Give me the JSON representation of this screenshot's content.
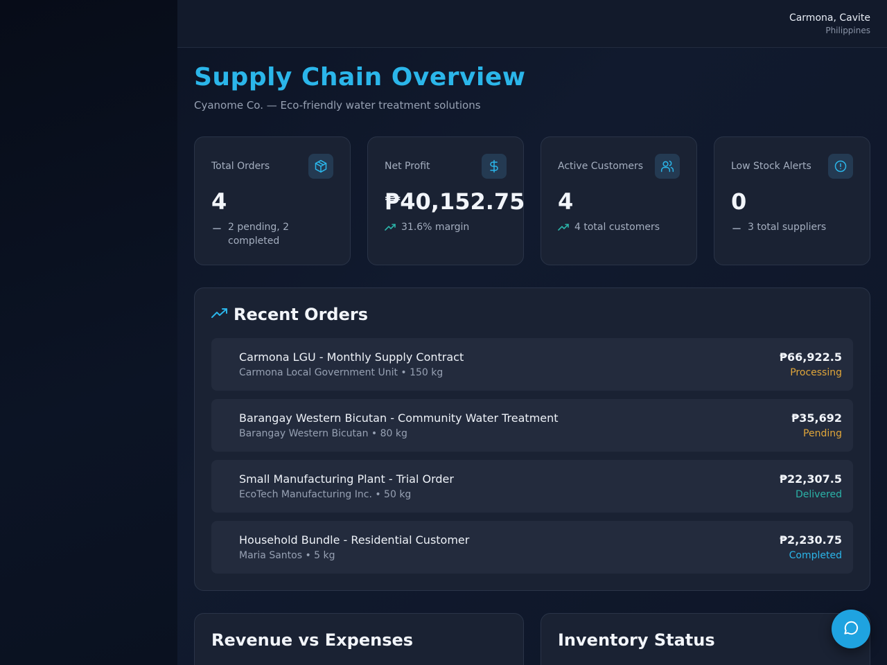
{
  "header": {
    "city": "Carmona, Cavite",
    "country": "Philippines"
  },
  "page": {
    "title": "Supply Chain Overview",
    "subtitle": "Cyanome Co. — Eco-friendly water treatment solutions"
  },
  "stats": [
    {
      "label": "Total Orders",
      "value": "4",
      "footnote": "2 pending, 2 completed",
      "icon": "package-icon",
      "trend": "neutral"
    },
    {
      "label": "Net Profit",
      "value": "₱40,152.75",
      "footnote": "31.6% margin",
      "icon": "dollar-icon",
      "trend": "up"
    },
    {
      "label": "Active Customers",
      "value": "4",
      "footnote": "4 total customers",
      "icon": "users-icon",
      "trend": "up"
    },
    {
      "label": "Low Stock Alerts",
      "value": "0",
      "footnote": "3 total suppliers",
      "icon": "alert-circle-icon",
      "trend": "neutral"
    }
  ],
  "orders": {
    "title": "Recent Orders",
    "items": [
      {
        "name": "Carmona LGU - Monthly Supply Contract",
        "meta": "Carmona Local Government Unit • 150 kg",
        "amount": "₱66,922.5",
        "status": "Processing",
        "status_color": "#e0a63a"
      },
      {
        "name": "Barangay Western Bicutan - Community Water Treatment",
        "meta": "Barangay Western Bicutan • 80 kg",
        "amount": "₱35,692",
        "status": "Pending",
        "status_color": "#e0a63a"
      },
      {
        "name": "Small Manufacturing Plant - Trial Order",
        "meta": "EcoTech Manufacturing Inc. • 50 kg",
        "amount": "₱22,307.5",
        "status": "Delivered",
        "status_color": "#2bb3a8"
      },
      {
        "name": "Household Bundle - Residential Customer",
        "meta": "Maria Santos • 5 kg",
        "amount": "₱2,230.75",
        "status": "Completed",
        "status_color": "#2bb6ea"
      }
    ]
  },
  "sections": {
    "revenue_title": "Revenue vs Expenses",
    "inventory_title": "Inventory Status"
  },
  "colors": {
    "accent": "#2bb6ea",
    "icon_bg": "#243a52",
    "trend_up": "#2bb3a8",
    "neutral": "#8a94a7"
  }
}
